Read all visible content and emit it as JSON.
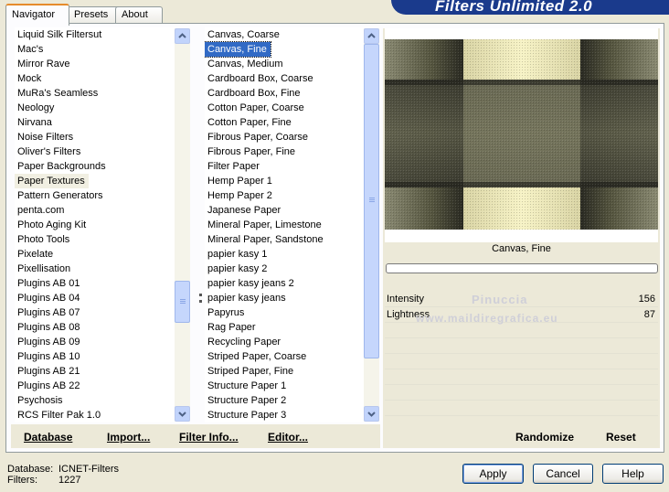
{
  "header": {
    "title": "Filters Unlimited 2.0"
  },
  "tabs": [
    {
      "label": "Navigator",
      "active": true
    },
    {
      "label": "Presets",
      "active": false
    },
    {
      "label": "About",
      "active": false
    }
  ],
  "categories": {
    "items": [
      "Liquid Silk Filtersut",
      "Mac's",
      "Mirror Rave",
      "Mock",
      "MuRa's Seamless",
      "Neology",
      "Nirvana",
      "Noise Filters",
      "Oliver's Filters",
      "Paper Backgrounds",
      "Paper Textures",
      "Pattern Generators",
      "penta.com",
      "Photo Aging Kit",
      "Photo Tools",
      "Pixelate",
      "Pixellisation",
      "Plugins AB 01",
      "Plugins AB 04",
      "Plugins AB 07",
      "Plugins AB 08",
      "Plugins AB 09",
      "Plugins AB 10",
      "Plugins AB 21",
      "Plugins AB 22",
      "Psychosis",
      "RCS Filter Pak 1.0"
    ],
    "selected_index": 10
  },
  "filters": {
    "items": [
      "Canvas, Coarse",
      "Canvas, Fine",
      "Canvas, Medium",
      "Cardboard Box, Coarse",
      "Cardboard Box, Fine",
      "Cotton Paper, Coarse",
      "Cotton Paper, Fine",
      "Fibrous Paper, Coarse",
      "Fibrous Paper, Fine",
      "Filter Paper",
      "Hemp Paper 1",
      "Hemp Paper 2",
      "Japanese Paper",
      "Mineral Paper, Limestone",
      "Mineral Paper, Sandstone",
      "papier kasy 1",
      "papier kasy 2",
      "papier kasy jeans 2",
      "papier kasy jeans",
      "Papyrus",
      "Rag Paper",
      "Recycling Paper",
      "Striped Paper, Coarse",
      "Striped Paper, Fine",
      "Structure Paper 1",
      "Structure Paper 2",
      "Structure Paper 3"
    ],
    "selected_index": 1
  },
  "list_buttons": {
    "database": "Database",
    "import": "Import...",
    "filter_info": "Filter Info...",
    "editor": "Editor..."
  },
  "preview": {
    "filter_name": "Canvas, Fine",
    "colors": {
      "dark": "#2b2b24",
      "mid": "#6b6b56",
      "light": "#f3efc0"
    }
  },
  "params": [
    {
      "label": "Intensity",
      "value": "156"
    },
    {
      "label": "Lightness",
      "value": "87"
    }
  ],
  "watermark": {
    "line1": "Pinuccia",
    "line2": "www.maildiregrafica.eu"
  },
  "preview_buttons": {
    "randomize": "Randomize",
    "reset": "Reset"
  },
  "footer": {
    "database_label": "Database:",
    "database_value": "ICNET-Filters",
    "filters_label": "Filters:",
    "filters_value": "1227",
    "apply": "Apply",
    "cancel": "Cancel",
    "help": "Help"
  }
}
